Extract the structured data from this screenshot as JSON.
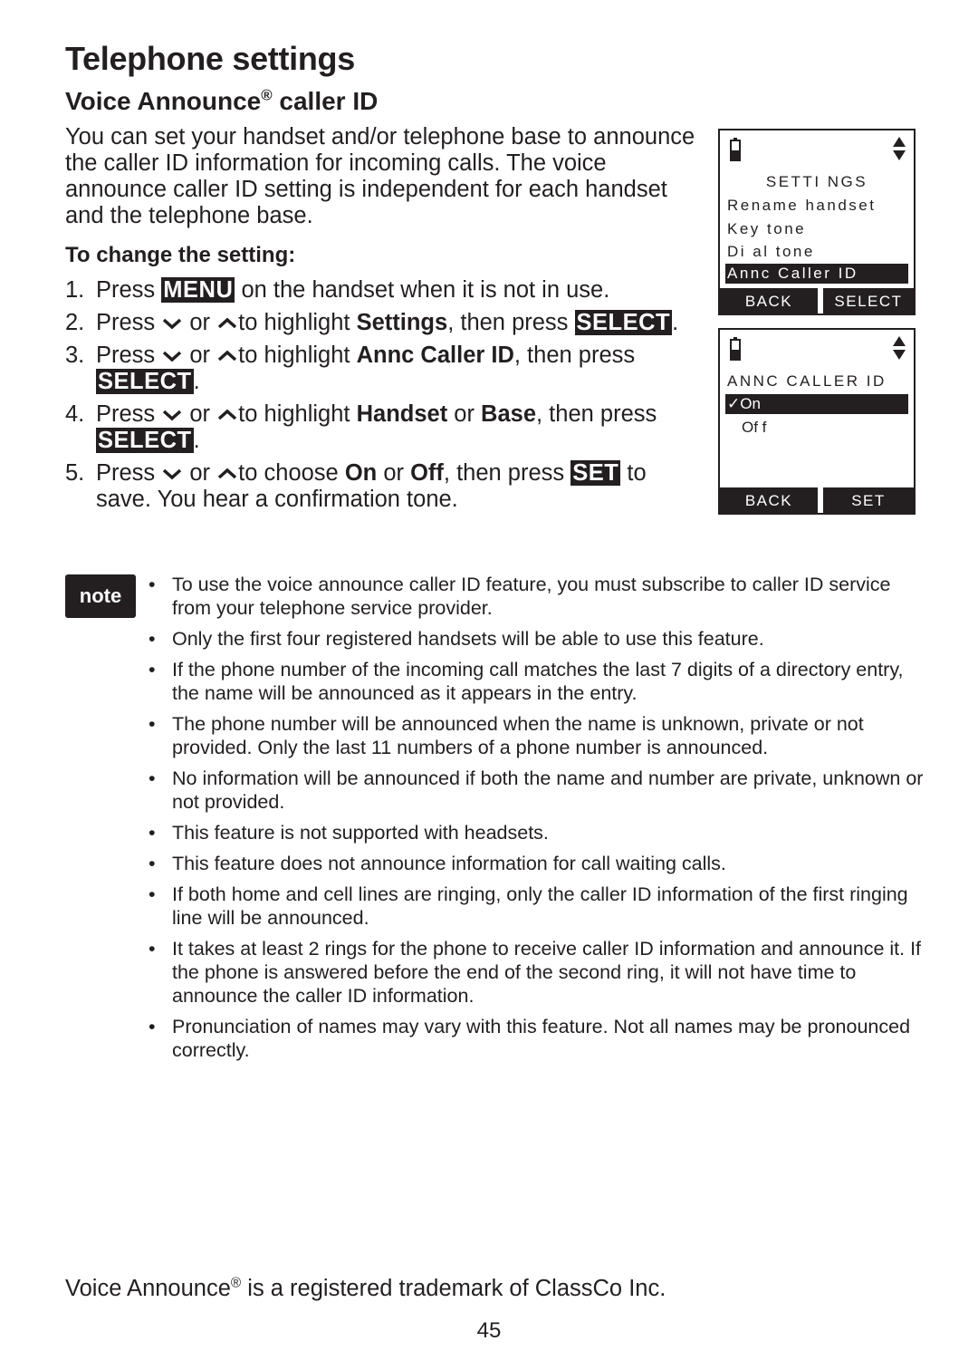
{
  "page": {
    "title": "Telephone settings",
    "section_title": "Voice Announce",
    "section_title_mark": "®",
    "section_title_suffix": " caller ID",
    "intro": "You can set your handset and/or telephone base to announce the caller ID information for incoming calls. The voice announce caller ID setting is independent for each handset and the telephone base.",
    "subheading": "To change the setting:",
    "page_number": "45"
  },
  "steps": [
    {
      "num": "1.",
      "parts": [
        "Press ",
        "MENU",
        " on the handset when it is not in use."
      ]
    },
    {
      "num": "2.",
      "parts": [
        "Press ",
        "or",
        "to highlight ",
        "Settings",
        ", then press ",
        "SELECT",
        "."
      ]
    },
    {
      "num": "3.",
      "parts": [
        "Press ",
        "or",
        "to highlight ",
        "Annc Caller ID",
        ", then press ",
        "SELECT",
        "."
      ]
    },
    {
      "num": "4.",
      "parts": [
        "Press ",
        "or",
        "to highlight ",
        "Handset",
        " or ",
        "Base",
        ", then press ",
        "SELECT",
        "."
      ]
    },
    {
      "num": "5.",
      "parts": [
        "Press ",
        "or",
        "to choose ",
        "On",
        " or ",
        "Off",
        ", then press ",
        "SET",
        " to save. You hear a confirmation tone."
      ]
    }
  ],
  "icons": {
    "down": "down-arrow-key",
    "up": "up-arrow-key",
    "battery": "battery-icon",
    "scroll": "scroll-arrows-icon"
  },
  "screen1": {
    "title": "SETTI NGS",
    "items": [
      "Rename handset",
      "Key tone",
      "Di al tone",
      "Annc Caller ID"
    ],
    "selected_index": 3,
    "softkey_left": "BACK",
    "softkey_right": "SELECT"
  },
  "screen2": {
    "title": "ANNC CALLER ID",
    "items": [
      "✓On",
      "Of f"
    ],
    "selected_index": 0,
    "softkey_left": "BACK",
    "softkey_right": "SET"
  },
  "note": {
    "badge": "note",
    "items": [
      "To use the voice announce caller ID feature, you must subscribe to caller ID service from your telephone service provider.",
      "Only the first four registered handsets will be able to use this feature.",
      "If the phone number of the incoming call matches the last 7 digits of a directory entry, the name will be announced as it appears in the entry.",
      "The phone number will be announced when the name is unknown, private or not provided. Only the last 11 numbers of a phone number is announced.",
      "No information will be announced if both the name and number are private, unknown or not provided.",
      "This feature is not supported with headsets.",
      "This feature does not announce information for call waiting calls.",
      "If both home and cell lines are ringing, only the caller ID information of the first ringing line will be announced.",
      "It takes at least 2 rings for the phone to receive caller ID information and announce it. If the phone is answered before the end of the second ring, it will not have time to announce the caller ID information.",
      "Pronunciation of names may vary with this feature. Not all names may be pronounced correctly."
    ]
  },
  "footer": {
    "prefix": "Voice Announce",
    "mark": "®",
    "suffix": " is a registered trademark of ClassCo Inc."
  }
}
